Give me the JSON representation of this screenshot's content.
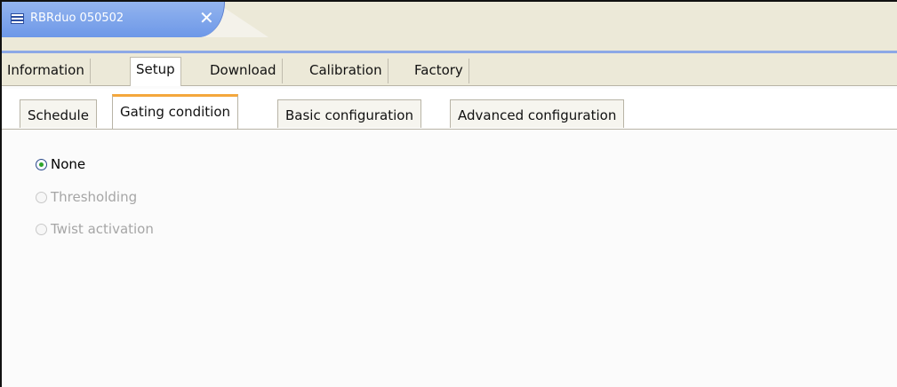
{
  "editor": {
    "title": "RBRduo 050502",
    "icon": "table-icon",
    "close_icon": "close-icon"
  },
  "main_tabs": [
    "Information",
    "Setup",
    "Download",
    "Calibration",
    "Factory"
  ],
  "main_active": "Setup",
  "sub_tabs": [
    "Schedule",
    "Gating condition",
    "Basic configuration",
    "Advanced configuration"
  ],
  "sub_active": "Gating condition",
  "options": [
    {
      "label": "None",
      "checked": true,
      "enabled": true
    },
    {
      "label": "Thresholding",
      "checked": false,
      "enabled": false
    },
    {
      "label": "Twist activation",
      "checked": false,
      "enabled": false
    }
  ],
  "colors": {
    "editor_tab": "#7aa0ea",
    "active_sub_tab_accent": "#f4a73c",
    "radio_checked": "#2fa52b"
  }
}
